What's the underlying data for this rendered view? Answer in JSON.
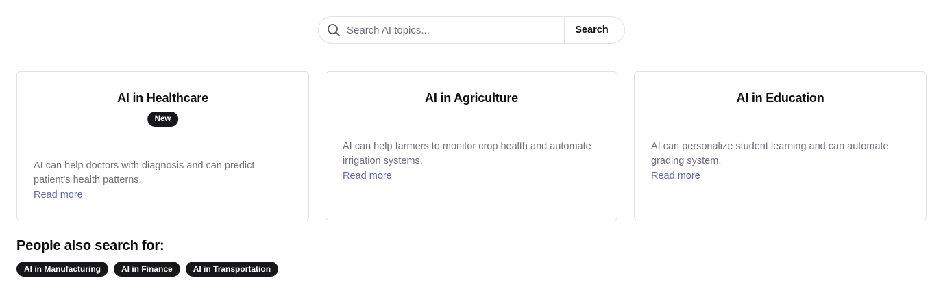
{
  "search": {
    "placeholder": "Search AI topics...",
    "value": "",
    "button_label": "Search",
    "icon": "search-icon"
  },
  "cards": [
    {
      "title": "AI in Healthcare",
      "badge": "New",
      "description": "AI can help doctors with diagnosis and can predict patient's health patterns.",
      "link": "Read more"
    },
    {
      "title": "AI in Agriculture",
      "description": "AI can help farmers to monitor crop health and automate irrigation systems.",
      "link": "Read more"
    },
    {
      "title": "AI in Education",
      "description": "AI can personalize student learning and can automate grading system.",
      "link": "Read more"
    }
  ],
  "related": {
    "title": "People also search for:",
    "chips": [
      "AI in Manufacturing",
      "AI in Finance",
      "AI in Transportation"
    ]
  },
  "colors": {
    "link": "#6366b8",
    "badge_bg": "#18181b",
    "muted_text": "#71717a",
    "border": "#e1e1e6"
  }
}
